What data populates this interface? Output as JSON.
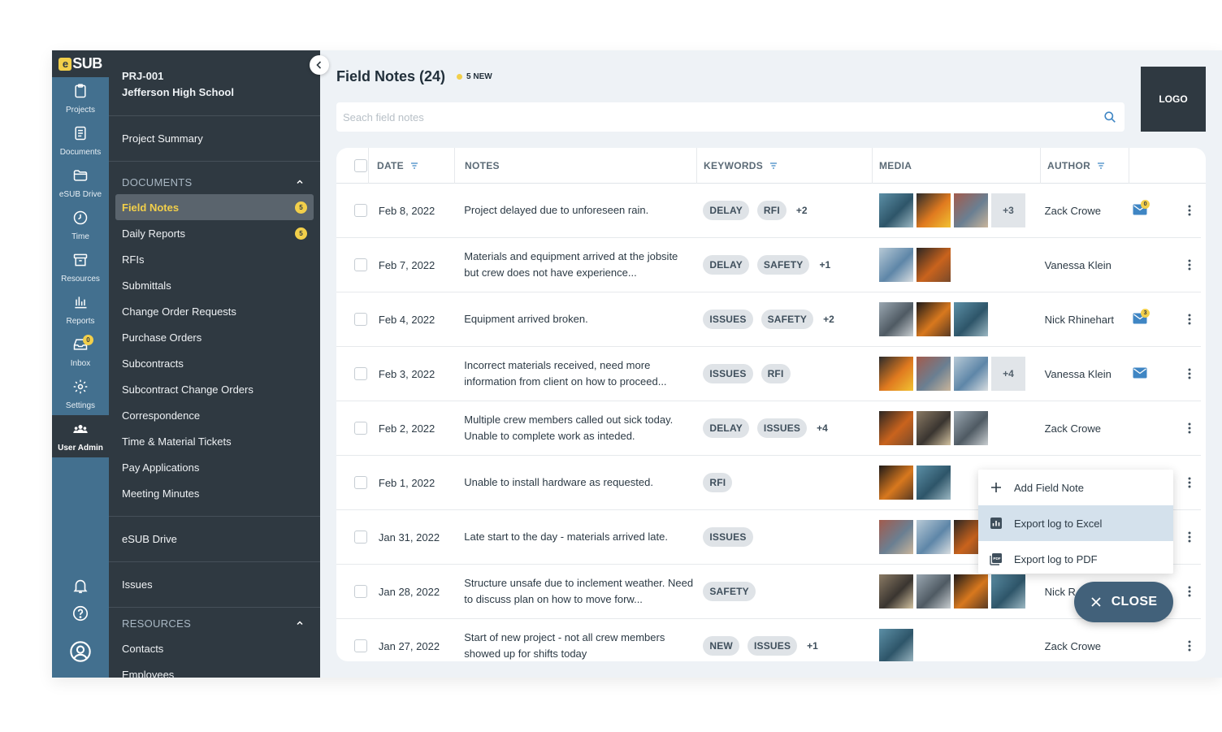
{
  "brand": {
    "logo_text": "SUB",
    "logo_mark": "e"
  },
  "rail": {
    "items": [
      {
        "label": "Projects",
        "icon": "clipboard-icon"
      },
      {
        "label": "Documents",
        "icon": "document-icon"
      },
      {
        "label": "eSUB Drive",
        "icon": "folder-icon"
      },
      {
        "label": "Time",
        "icon": "clock-icon"
      },
      {
        "label": "Resources",
        "icon": "archive-icon"
      },
      {
        "label": "Reports",
        "icon": "bar-chart-icon"
      },
      {
        "label": "Inbox",
        "icon": "inbox-icon",
        "badge": "0"
      },
      {
        "label": "Settings",
        "icon": "gear-icon"
      },
      {
        "label": "User Admin",
        "icon": "users-icon"
      }
    ]
  },
  "project": {
    "code": "PRJ-001",
    "name": "Jefferson High School"
  },
  "sidebar": {
    "summary": "Project Summary",
    "documents_header": "DOCUMENTS",
    "documents": [
      {
        "label": "Field Notes",
        "badge": "5"
      },
      {
        "label": "Daily Reports",
        "badge": "5"
      },
      {
        "label": "RFIs"
      },
      {
        "label": "Submittals"
      },
      {
        "label": "Change Order Requests"
      },
      {
        "label": "Purchase Orders"
      },
      {
        "label": "Subcontracts"
      },
      {
        "label": "Subcontract Change Orders"
      },
      {
        "label": "Correspondence"
      },
      {
        "label": "Time & Material Tickets"
      },
      {
        "label": "Pay Applications"
      },
      {
        "label": "Meeting Minutes"
      }
    ],
    "drive": "eSUB Drive",
    "issues": "Issues",
    "resources_header": "RESOURCES",
    "resources": [
      {
        "label": "Contacts"
      },
      {
        "label": "Employees"
      }
    ]
  },
  "header": {
    "title": "Field Notes (24)",
    "new_label": "5 NEW",
    "logo": "LOGO"
  },
  "search": {
    "placeholder": "Seach field notes",
    "value": ""
  },
  "table": {
    "columns": {
      "date": "DATE",
      "notes": "NOTES",
      "keywords": "KEYWORDS",
      "media": "MEDIA",
      "author": "AUTHOR"
    },
    "rows": [
      {
        "date": "Feb 8, 2022",
        "note": "Project delayed due to unforeseen rain.",
        "keywords": [
          "DELAY",
          "RFI"
        ],
        "more_kw": "+2",
        "media": 3,
        "more_media": "+3",
        "author": "Zack Crowe",
        "mail": true,
        "mail_badge": "0"
      },
      {
        "date": "Feb 7, 2022",
        "note": "Materials and equipment arrived at the jobsite but crew does not have experience...",
        "keywords": [
          "DELAY",
          "SAFETY"
        ],
        "more_kw": "+1",
        "media": 2,
        "more_media": "",
        "author": "Vanessa Klein",
        "mail": false
      },
      {
        "date": "Feb 4, 2022",
        "note": "Equipment arrived broken.",
        "keywords": [
          "ISSUES",
          "SAFETY"
        ],
        "more_kw": "+2",
        "media": 3,
        "more_media": "",
        "author": "Nick Rhinehart",
        "mail": true,
        "mail_badge": "3"
      },
      {
        "date": "Feb 3, 2022",
        "note": "Incorrect materials received, need more information from client on how to proceed...",
        "keywords": [
          "ISSUES",
          "RFI"
        ],
        "more_kw": "",
        "media": 3,
        "more_media": "+4",
        "author": "Vanessa Klein",
        "mail": true,
        "mail_badge": ""
      },
      {
        "date": "Feb 2, 2022",
        "note": "Multiple crew members called out sick today. Unable to complete work as inteded.",
        "keywords": [
          "DELAY",
          "ISSUES"
        ],
        "more_kw": "+4",
        "media": 3,
        "more_media": "",
        "author": "Zack Crowe",
        "mail": false
      },
      {
        "date": "Feb 1, 2022",
        "note": "Unable to install hardware as requested.",
        "keywords": [
          "RFI"
        ],
        "more_kw": "",
        "media": 2,
        "more_media": "",
        "author": "",
        "mail": false
      },
      {
        "date": "Jan 31, 2022",
        "note": "Late start to the day - materials arrived late.",
        "keywords": [
          "ISSUES"
        ],
        "more_kw": "",
        "media": 3,
        "more_media": "",
        "author": "",
        "mail": false
      },
      {
        "date": "Jan 28, 2022",
        "note": "Structure unsafe due to inclement weather. Need to discuss plan on how to move forw...",
        "keywords": [
          "SAFETY"
        ],
        "more_kw": "",
        "media": 4,
        "more_media": "",
        "author": "Nick R",
        "mail": false
      },
      {
        "date": "Jan 27, 2022",
        "note": "Start of new project - not all crew members showed up for shifts today",
        "keywords": [
          "NEW",
          "ISSUES"
        ],
        "more_kw": "+1",
        "media": 1,
        "more_media": "",
        "author": "Zack Crowe",
        "mail": false
      }
    ]
  },
  "menu": {
    "items": [
      {
        "label": "Add Field Note",
        "icon": "plus-icon"
      },
      {
        "label": "Export log to Excel",
        "icon": "excel-chart-icon"
      },
      {
        "label": "Export log to PDF",
        "icon": "pdf-icon"
      }
    ]
  },
  "fab": {
    "label": "CLOSE"
  },
  "colors": {
    "rail": "#43708f",
    "sidebar": "#2f3941",
    "accent": "#f2cf4a",
    "fab": "#42617a",
    "highlight": "#d4e1ec"
  }
}
